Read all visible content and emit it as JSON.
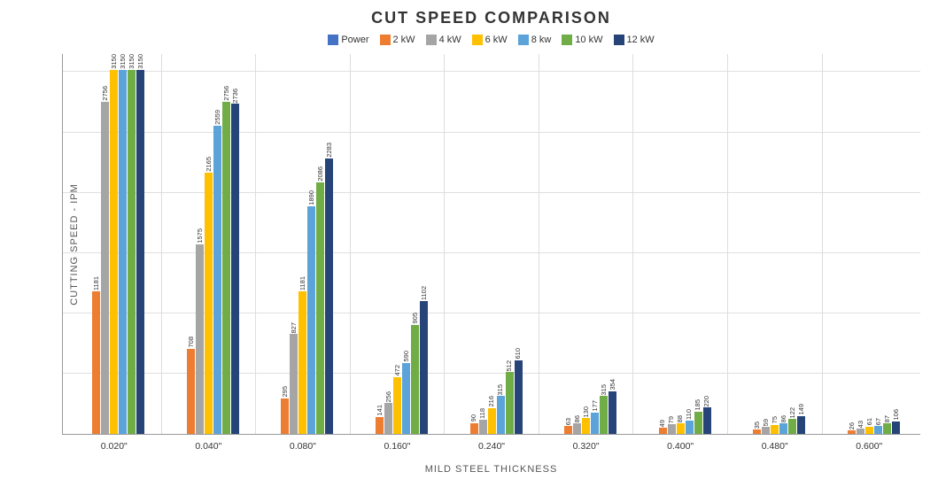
{
  "title": "CUT SPEED COMPARISON",
  "yAxisLabel": "CUTTING SPEED - IPM",
  "xAxisLabel": "MILD STEEL THICKNESS",
  "legend": [
    {
      "label": "Power",
      "color": "#4472C4"
    },
    {
      "label": "2 kW",
      "color": "#ED7D31"
    },
    {
      "label": "4 kW",
      "color": "#A5A5A5"
    },
    {
      "label": "6 kW",
      "color": "#FFC000"
    },
    {
      "label": "8 kw",
      "color": "#5BA3D9"
    },
    {
      "label": "10 kW",
      "color": "#70AD47"
    },
    {
      "label": "12 kW",
      "color": "#264478"
    }
  ],
  "maxValue": 3150,
  "groups": [
    {
      "label": "0.020\"",
      "bars": [
        {
          "value": null,
          "color": "#4472C4"
        },
        {
          "value": 1181,
          "color": "#ED7D31"
        },
        {
          "value": 2756,
          "color": "#A5A5A5"
        },
        {
          "value": 3150,
          "color": "#FFC000"
        },
        {
          "value": 3150,
          "color": "#5BA3D9"
        },
        {
          "value": 3150,
          "color": "#70AD47"
        },
        {
          "value": 3150,
          "color": "#264478"
        }
      ]
    },
    {
      "label": "0.040\"",
      "bars": [
        {
          "value": null,
          "color": "#4472C4"
        },
        {
          "value": 708,
          "color": "#ED7D31"
        },
        {
          "value": 1575,
          "color": "#A5A5A5"
        },
        {
          "value": 2165,
          "color": "#FFC000"
        },
        {
          "value": 2559,
          "color": "#5BA3D9"
        },
        {
          "value": 2756,
          "color": "#70AD47"
        },
        {
          "value": 2736,
          "color": "#264478"
        }
      ]
    },
    {
      "label": "0.080\"",
      "bars": [
        {
          "value": null,
          "color": "#4472C4"
        },
        {
          "value": 295,
          "color": "#ED7D31"
        },
        {
          "value": 827,
          "color": "#A5A5A5"
        },
        {
          "value": 1181,
          "color": "#FFC000"
        },
        {
          "value": 1890,
          "color": "#5BA3D9"
        },
        {
          "value": 2086,
          "color": "#70AD47"
        },
        {
          "value": 2283,
          "color": "#264478"
        }
      ]
    },
    {
      "label": "0.160\"",
      "bars": [
        {
          "value": null,
          "color": "#4472C4"
        },
        {
          "value": 141,
          "color": "#ED7D31"
        },
        {
          "value": 256,
          "color": "#A5A5A5"
        },
        {
          "value": 472,
          "color": "#FFC000"
        },
        {
          "value": 590,
          "color": "#5BA3D9"
        },
        {
          "value": 905,
          "color": "#70AD47"
        },
        {
          "value": 1102,
          "color": "#264478"
        }
      ]
    },
    {
      "label": "0.240\"",
      "bars": [
        {
          "value": null,
          "color": "#4472C4"
        },
        {
          "value": 90,
          "color": "#ED7D31"
        },
        {
          "value": 118,
          "color": "#A5A5A5"
        },
        {
          "value": 216,
          "color": "#FFC000"
        },
        {
          "value": 315,
          "color": "#5BA3D9"
        },
        {
          "value": 512,
          "color": "#70AD47"
        },
        {
          "value": 610,
          "color": "#264478"
        }
      ]
    },
    {
      "label": "0.320\"",
      "bars": [
        {
          "value": null,
          "color": "#4472C4"
        },
        {
          "value": 63,
          "color": "#ED7D31"
        },
        {
          "value": 86,
          "color": "#A5A5A5"
        },
        {
          "value": 130,
          "color": "#FFC000"
        },
        {
          "value": 177,
          "color": "#5BA3D9"
        },
        {
          "value": 315,
          "color": "#70AD47"
        },
        {
          "value": 354,
          "color": "#264478"
        }
      ]
    },
    {
      "label": "0.400\"",
      "bars": [
        {
          "value": null,
          "color": "#4472C4"
        },
        {
          "value": 49,
          "color": "#ED7D31"
        },
        {
          "value": 79,
          "color": "#A5A5A5"
        },
        {
          "value": 88,
          "color": "#FFC000"
        },
        {
          "value": 110,
          "color": "#5BA3D9"
        },
        {
          "value": 185,
          "color": "#70AD47"
        },
        {
          "value": 220,
          "color": "#264478"
        }
      ]
    },
    {
      "label": "0.480\"",
      "bars": [
        {
          "value": null,
          "color": "#4472C4"
        },
        {
          "value": 35,
          "color": "#ED7D31"
        },
        {
          "value": 59,
          "color": "#A5A5A5"
        },
        {
          "value": 75,
          "color": "#FFC000"
        },
        {
          "value": 86,
          "color": "#5BA3D9"
        },
        {
          "value": 122,
          "color": "#70AD47"
        },
        {
          "value": 149,
          "color": "#264478"
        }
      ]
    },
    {
      "label": "0.600\"",
      "bars": [
        {
          "value": null,
          "color": "#4472C4"
        },
        {
          "value": 26,
          "color": "#ED7D31"
        },
        {
          "value": 43,
          "color": "#A5A5A5"
        },
        {
          "value": 61,
          "color": "#FFC000"
        },
        {
          "value": 67,
          "color": "#5BA3D9"
        },
        {
          "value": 87,
          "color": "#70AD47"
        },
        {
          "value": 106,
          "color": "#264478"
        }
      ]
    }
  ]
}
